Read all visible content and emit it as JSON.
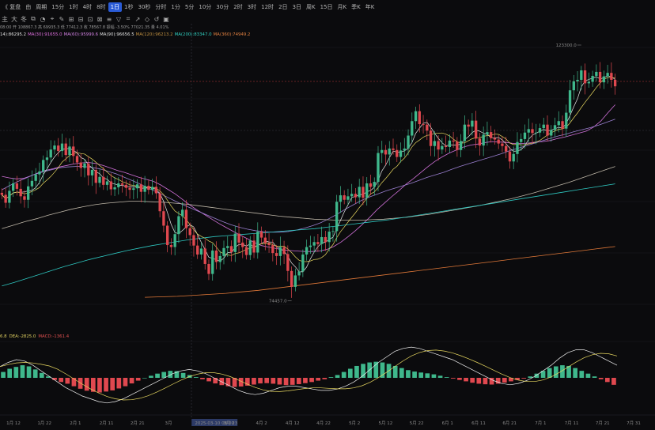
{
  "toolbar": {
    "replay_label": "《 复盘",
    "symbol_label": "由",
    "cycle_label": "周期",
    "intervals": [
      "15分",
      "1时",
      "4时",
      "8时",
      "1日",
      "1秒",
      "30秒",
      "分时",
      "1分",
      "5分",
      "10分",
      "30分",
      "2时",
      "3时",
      "12时",
      "2日",
      "3日",
      "周K",
      "15日",
      "月K",
      "季K",
      "年K"
    ],
    "active_interval": "1日"
  },
  "toolbar2": {
    "tools": [
      "主",
      "大",
      "冬",
      "⧉",
      "◔",
      "⌖",
      "✎",
      "⊞",
      "⊟",
      "⊡",
      "⊠",
      "≡",
      "▽",
      "⌗",
      "↗",
      "◇",
      "↺",
      "▣"
    ]
  },
  "ohlc_text": "08:00 开 108867.3 高 69935.3 低 77412.3 收 78567.8 振幅 -3.50% 77021.35 量 4.01%",
  "ma_legend": [
    {
      "text": "14):86295.2",
      "color": "#e0e0e0"
    },
    {
      "text": "MA(30):91655.0",
      "color": "#e070e0"
    },
    {
      "text": "MA(60):95999.6",
      "color": "#d080e0"
    },
    {
      "text": "MA(90):96656.5",
      "color": "#e0e0e0"
    },
    {
      "text": "MA(120):96213.2",
      "color": "#c09040"
    },
    {
      "text": "MA(200):83347.0",
      "color": "#30d0c0"
    },
    {
      "text": "MA(360):74949.2",
      "color": "#e08040"
    }
  ],
  "macd_legend": [
    {
      "text": "6.8",
      "color": "#e0d060"
    },
    {
      "text": "DEA:-2825.0",
      "color": "#e0d060"
    },
    {
      "text": "MACD:-1361.4",
      "color": "#e05050"
    }
  ],
  "colors": {
    "up": "#3fb88c",
    "down": "#e0484f",
    "background": "#0b0b0d",
    "grid": "#1d1d22",
    "ma_fast": "#e8e8e8",
    "ma_yellow": "#e8d860",
    "ma_pink": "#d070d8",
    "ma_purple": "#9a7fd0",
    "ma_teal": "#2ec7c0",
    "ma_orange": "#e07838"
  },
  "chart_data": {
    "type": "candlestick",
    "title": "",
    "x_ticks": [
      "1月 12",
      "1月 22",
      "2月 1",
      "2月 11",
      "2月 21",
      "3月",
      "2025-03-10 08:00",
      "3月 23",
      "4月 2",
      "4月 12",
      "4月 22",
      "5月 2",
      "5月 12",
      "5月 22",
      "6月 1",
      "6月 11",
      "6月 21",
      "7月 1",
      "7月 11",
      "7月 21",
      "7月 31"
    ],
    "price_annotations": [
      {
        "label": "123300.0",
        "value": 123300
      },
      {
        "label": "74457.0",
        "value": 74457
      }
    ],
    "y_range": [
      72000,
      126000
    ],
    "dashed_price_level": 119000,
    "closes": [
      94800,
      93200,
      95600,
      97100,
      96000,
      94500,
      93800,
      96500,
      97600,
      98900,
      99500,
      101800,
      102300,
      103900,
      104700,
      103600,
      105100,
      102800,
      104500,
      102600,
      101300,
      100200,
      101100,
      98700,
      99800,
      97200,
      98400,
      96800,
      97500,
      95900,
      96300,
      97100,
      96800,
      96200,
      95800,
      96100,
      96900,
      95400,
      96600,
      95800,
      96400,
      95100,
      91500,
      88600,
      84700,
      84300,
      86900,
      90500,
      91800,
      88100,
      86700,
      84600,
      82800,
      84000,
      80900,
      78900,
      83600,
      81300,
      82500,
      84100,
      84500,
      83300,
      87000,
      85200,
      84300,
      82700,
      85600,
      83200,
      87400,
      86200,
      85100,
      84700,
      83100,
      82500,
      84300,
      82900,
      79500,
      76300,
      78600,
      79400,
      82800,
      84300,
      84600,
      85300,
      84900,
      86300,
      85300,
      87400,
      87500,
      93400,
      94700,
      93800,
      94500,
      95000,
      94300,
      96400,
      94200,
      97100,
      96400,
      97400,
      103200,
      103800,
      102900,
      104100,
      103800,
      102400,
      103700,
      104100,
      106700,
      109600,
      111600,
      109000,
      108900,
      107700,
      104600,
      105600,
      103900,
      104600,
      104400,
      105700,
      105500,
      103800,
      105600,
      108900,
      108500,
      109700,
      106100,
      104700,
      106900,
      107400,
      106200,
      105900,
      105100,
      104600,
      103500,
      101500,
      103000,
      105400,
      106000,
      107300,
      108000,
      107200,
      107300,
      108200,
      108900,
      106700,
      107800,
      108800,
      109600,
      108100,
      111300,
      115800,
      117600,
      117900,
      119800,
      117200,
      117500,
      118700,
      119500,
      117400,
      118600,
      119300,
      117900,
      116600
    ],
    "series": [
      {
        "name": "MA(30)",
        "values": [
          98500,
          98200,
          98000,
          98100,
          98600,
          99200,
          99700,
          100000,
          100400,
          100700,
          101000,
          101200,
          101300,
          101100,
          100700,
          100200,
          99700,
          99300,
          98800,
          98300,
          97900,
          97500,
          96800,
          95900,
          95000,
          93900,
          92800,
          91800,
          90900,
          90000,
          89100,
          88300,
          87500,
          86700,
          86000,
          85200,
          84600,
          84300,
          84000,
          83700,
          83600,
          83500,
          83400,
          83400,
          83500,
          83800,
          84400,
          85300,
          86400,
          87600,
          88900,
          90300,
          91800,
          93100,
          94400,
          95600,
          96900,
          98000,
          99200,
          100400,
          101500,
          102400,
          103200,
          103800,
          104400,
          104800,
          105000,
          105300,
          105500,
          105400,
          105300,
          105100,
          105100,
          105200,
          105400,
          105500,
          105700,
          106100,
          106400,
          106800,
          107200,
          107600,
          108400,
          109600,
          111300,
          112900
        ]
      },
      {
        "name": "MA(60)",
        "values": [
          95800,
          96700,
          97500,
          98200,
          98900,
          99400,
          99800,
          100200,
          100400,
          100500,
          100500,
          100300,
          100000,
          99500,
          99000,
          98300,
          97600,
          96900,
          96100,
          95300,
          94500,
          93700,
          92900,
          92200,
          91500,
          90800,
          90100,
          89400,
          88800,
          88300,
          87900,
          87600,
          87400,
          87300,
          87300,
          87400,
          87700,
          88100,
          88600,
          89200,
          90000,
          90900,
          91900,
          92800,
          93700,
          94400,
          95000,
          95600,
          96100,
          96600,
          97100,
          97700,
          98300,
          98800,
          99300,
          99900,
          100500,
          101000,
          101500,
          102000,
          102500,
          103000,
          103600,
          104100,
          104600,
          105100,
          105600,
          106100,
          106600,
          107000,
          107500,
          107900,
          108300,
          108800,
          109400,
          110000
        ]
      },
      {
        "name": "MA(120)",
        "values": [
          88000,
          88700,
          89400,
          90000,
          90700,
          91300,
          91900,
          92400,
          92800,
          93100,
          93300,
          93500,
          93500,
          93400,
          93300,
          93100,
          92900,
          92600,
          92300,
          92000,
          91700,
          91400,
          91100,
          90800,
          90500,
          90300,
          90100,
          89900,
          89800,
          89700,
          89700,
          89700,
          89800,
          89900,
          90100,
          90300,
          90600,
          90900,
          91300,
          91700,
          92100,
          92500,
          93000,
          93500,
          94000,
          94600,
          95200,
          95900,
          96600,
          97300,
          98100,
          98900,
          99700,
          100500
        ]
      },
      {
        "name": "MA(200)",
        "values": [
          76500,
          77200,
          78000,
          78800,
          79600,
          80400,
          81100,
          81800,
          82400,
          83000,
          83600,
          84100,
          84600,
          85000,
          85400,
          85800,
          86100,
          86400,
          86600,
          86800,
          87000,
          87200,
          87400,
          87600,
          87800,
          88000,
          88300,
          88600,
          88900,
          89200,
          89500,
          89800,
          90200,
          90600,
          91000,
          91400,
          91800,
          92200,
          92600,
          93000,
          93400,
          93800,
          94200,
          94600,
          95000,
          95400,
          95800,
          96200,
          96600,
          97000
        ]
      },
      {
        "name": "MA(360)",
        "values": [
          74200,
          74300,
          74400,
          74600,
          74800,
          75000,
          75300,
          75600,
          76000,
          76400,
          76800,
          77200,
          77600,
          78000,
          78400,
          78800,
          79200,
          79600,
          80000,
          80400,
          80800,
          81200,
          81600,
          82000,
          82400,
          82800,
          83200,
          83600,
          84000,
          84400
        ]
      }
    ],
    "macd": {
      "histogram": [
        420,
        650,
        780,
        900,
        820,
        600,
        350,
        100,
        -150,
        -300,
        -420,
        -600,
        -780,
        -920,
        -1000,
        -1050,
        -980,
        -900,
        -760,
        -600,
        -400,
        -200,
        0,
        150,
        300,
        420,
        500,
        480,
        350,
        200,
        50,
        -100,
        -250,
        -400,
        -520,
        -600,
        -650,
        -620,
        -560,
        -480,
        -400,
        -380,
        -420,
        -480,
        -520,
        -500,
        -450,
        -380,
        -300,
        -200,
        -100,
        50,
        200,
        420,
        650,
        850,
        1000,
        1100,
        1150,
        1100,
        1000,
        850,
        700,
        550,
        450,
        380,
        320,
        250,
        150,
        50,
        -50,
        -150,
        -250,
        -350,
        -420,
        -460,
        -480,
        -420,
        -340,
        -250,
        -150,
        -50,
        100,
        300,
        500,
        700,
        820,
        900,
        850,
        700,
        500,
        300,
        100,
        -100,
        -300,
        -500
      ],
      "dif": [
        800,
        1100,
        1300,
        1200,
        900,
        500,
        100,
        -300,
        -700,
        -1000,
        -1300,
        -1500,
        -1700,
        -1800,
        -1700,
        -1500,
        -1200,
        -900,
        -600,
        -300,
        0,
        300,
        500,
        600,
        500,
        300,
        0,
        -300,
        -600,
        -900,
        -1100,
        -1200,
        -1100,
        -900,
        -700,
        -600,
        -600,
        -700,
        -800,
        -900,
        -900,
        -800,
        -600,
        -300,
        100,
        600,
        1100,
        1500,
        1900,
        2100,
        2200,
        2100,
        1900,
        1700,
        1500,
        1300,
        1000,
        700,
        400,
        100,
        -200,
        -400,
        -500,
        -400,
        -200,
        100,
        500,
        900,
        1400,
        1800,
        2000,
        2000,
        1800,
        1500,
        1200,
        900
      ]
    },
    "macd_range": [
      -2600,
      2600
    ]
  }
}
